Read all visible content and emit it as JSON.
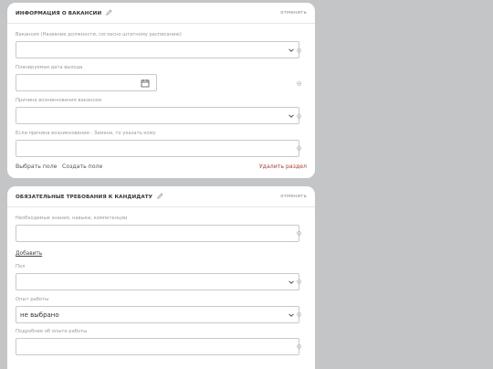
{
  "section_vacancy": {
    "title": "ИНФОРМАЦИЯ О ВАКАНСИИ",
    "cancel": "отменить",
    "fields": [
      {
        "label": "Вакансия (Название должности, согласно штатному расписанию)",
        "value": ""
      },
      {
        "label": "Планируемая дата выхода",
        "value": ""
      },
      {
        "label": "Причина возникновения вакансии",
        "value": ""
      },
      {
        "label": "Если причина возникновения - Замена, то указать кому",
        "value": ""
      }
    ],
    "choose_field": "Выбрать поле",
    "create_field": "Создать поле",
    "delete_section": "Удалить раздел"
  },
  "section_requirements": {
    "title": "ОБЯЗАТЕЛЬНЫЕ ТРЕБОВАНИЯ К КАНДИДАТУ",
    "cancel": "отменить",
    "fields": [
      {
        "label": "Необходимые знания, навыки, компетенции",
        "value": ""
      },
      {
        "label": "Пол",
        "value": ""
      },
      {
        "label": "Опыт работы",
        "value": "не выбрано"
      },
      {
        "label": "Подробнее об опыте работы",
        "value": ""
      }
    ],
    "add": "Добавить"
  },
  "colors": {
    "background": "#c3c5c6",
    "card": "#ffffff",
    "delete": "#c0392b"
  },
  "icons": [
    "pencil-icon",
    "chevron-down-icon",
    "calendar-icon",
    "gear-icon"
  ]
}
